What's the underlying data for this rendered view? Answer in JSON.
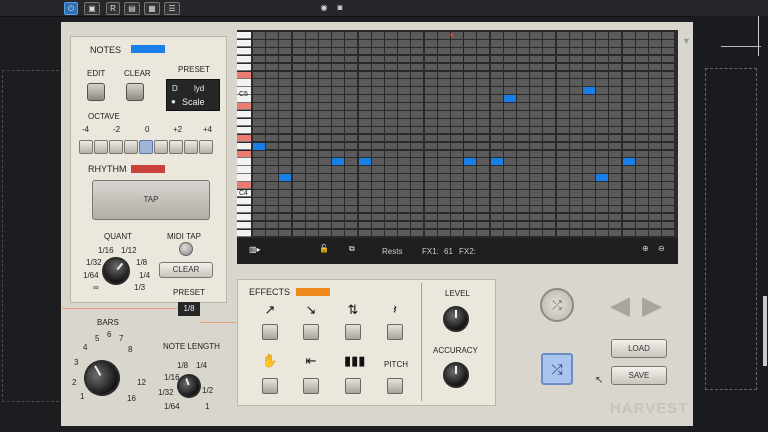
{
  "host": {
    "toolbar_icons": [
      "power-icon",
      "fx-icon",
      "record-icon",
      "mode-icon",
      "snapshot-icon",
      "camera-icon"
    ]
  },
  "notes": {
    "title": "NOTES",
    "edit_label": "EDIT",
    "clear_label": "CLEAR",
    "preset_label": "PRESET",
    "preset_root": "D",
    "preset_mode": "lyd",
    "preset_scale": "Scale",
    "octave_label": "OCTAVE",
    "octave_ticks": [
      "-4",
      "-2",
      "0",
      "+2",
      "+4"
    ],
    "accent": "#1a7ee8"
  },
  "rhythm": {
    "title": "RHYTHM",
    "tap_label": "TAP",
    "quant_label": "QUANT",
    "quant_values": [
      "1/16",
      "1/12",
      "1/32",
      "1/8",
      "1/64",
      "1/4",
      "∞",
      "1/3"
    ],
    "midi_tap_label": "MIDI TAP",
    "clear_label": "CLEAR",
    "preset_label": "PRESET",
    "preset_value": "1/8",
    "accent": "#c9403a"
  },
  "bars": {
    "label": "BARS",
    "values": [
      "5",
      "6",
      "7",
      "4",
      "8",
      "3",
      "12",
      "2",
      "16",
      "1"
    ]
  },
  "note_length": {
    "label": "NOTE LENGTH",
    "values": [
      "1/8",
      "1/16",
      "1/4",
      "1/32",
      "1/2",
      "1/64",
      "1"
    ]
  },
  "roll": {
    "c5_label": "C5",
    "c4_label": "C4",
    "rests_label": "Rests",
    "fx1_label": "FX1:",
    "fx1_value": "61",
    "fx2_label": "FX2:"
  },
  "effects": {
    "title": "EFFECTS",
    "pitch_label": "PITCH",
    "level_label": "LEVEL",
    "accuracy_label": "ACCURACY",
    "accent": "#f08a1c"
  },
  "actions": {
    "load_label": "LOAD",
    "save_label": "SAVE",
    "brand": "HARVEST"
  }
}
